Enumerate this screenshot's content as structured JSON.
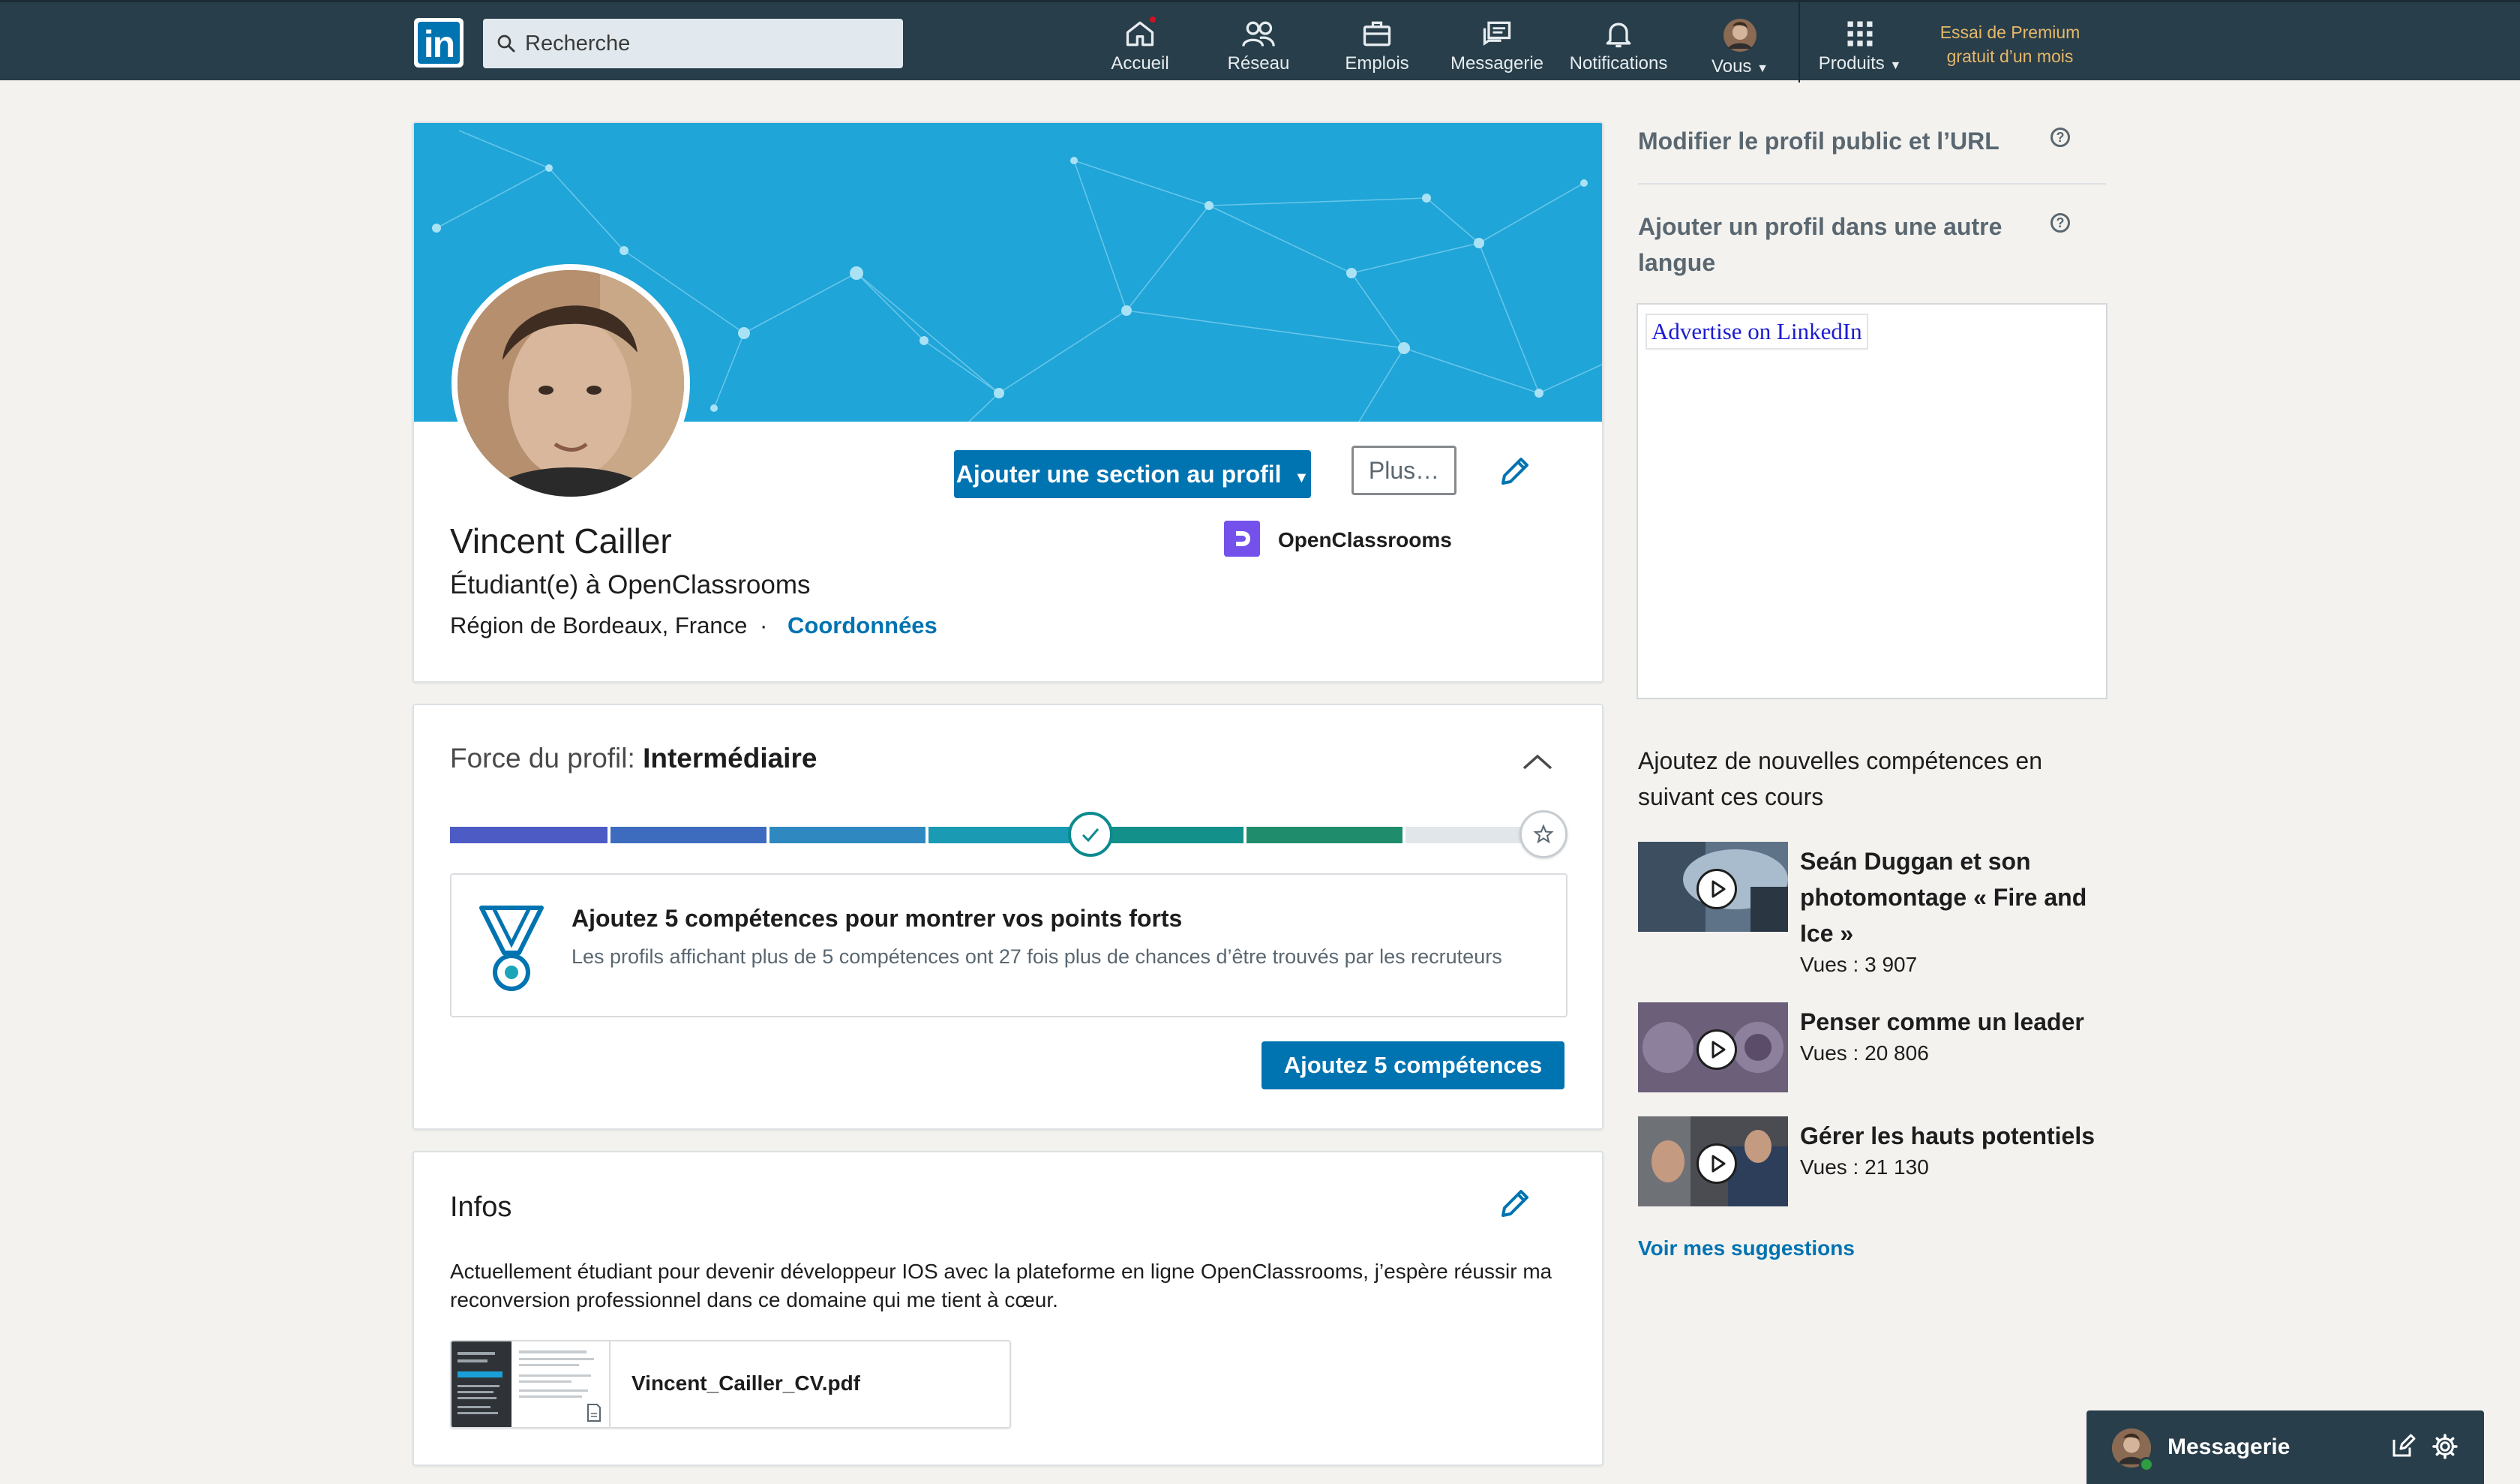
{
  "nav": {
    "logo": "in",
    "search_placeholder": "Recherche",
    "items": [
      {
        "label": "Accueil",
        "icon": "home-icon"
      },
      {
        "label": "Réseau",
        "icon": "network-icon"
      },
      {
        "label": "Emplois",
        "icon": "briefcase-icon"
      },
      {
        "label": "Messagerie",
        "icon": "messaging-icon"
      },
      {
        "label": "Notifications",
        "icon": "bell-icon"
      },
      {
        "label": "Vous",
        "icon": "avatar-icon"
      },
      {
        "label": "Produits",
        "icon": "grid-icon"
      }
    ],
    "premium_line1": "Essai de Premium",
    "premium_line2": "gratuit d’un mois"
  },
  "profile": {
    "add_section_label": "Ajouter une section au profil",
    "more_label": "Plus…",
    "name": "Vincent Cailler",
    "headline": "Étudiant(e) à OpenClassrooms",
    "location": "Région de Bordeaux, France",
    "separator": "·",
    "contact_label": "Coordonnées",
    "company": "OpenClassrooms"
  },
  "strength": {
    "label": "Force du profil:",
    "level": "Intermédiaire",
    "progress_fraction": 0.85,
    "tip_title": "Ajoutez 5 compétences pour montrer vos points forts",
    "tip_desc": "Les profils affichant plus de 5 compétences ont 27 fois plus de chances d’être trouvés par les recruteurs",
    "cta_label": "Ajoutez 5 compétences"
  },
  "infos": {
    "title": "Infos",
    "text": "Actuellement étudiant pour devenir développeur IOS avec la plateforme en ligne OpenClassrooms, j’espère réussir ma reconversion professionnel dans ce domaine qui me tient à cœur.",
    "file_name": "Vincent_Cailler_CV.pdf"
  },
  "rail": {
    "public_profile": "Modifier le profil public et l’URL",
    "other_language": "Ajouter un profil dans une autre langue",
    "ad_link": "Advertise on LinkedIn",
    "courses_title": "Ajoutez de nouvelles compétences en suivant ces cours",
    "courses": [
      {
        "title": "Seán Duggan et son photomontage « Fire and Ice »",
        "views": "Vues : 3 907"
      },
      {
        "title": "Penser comme un leader",
        "views": "Vues : 20 806"
      },
      {
        "title": "Gérer les hauts potentiels",
        "views": "Vues : 21 130"
      }
    ],
    "see_more": "Voir mes suggestions"
  },
  "messaging": {
    "label": "Messagerie"
  },
  "colors": {
    "navbar": "#283e4a",
    "brand": "#0073b1",
    "banner": "#1fa5d8",
    "premium": "#e6b86a"
  }
}
